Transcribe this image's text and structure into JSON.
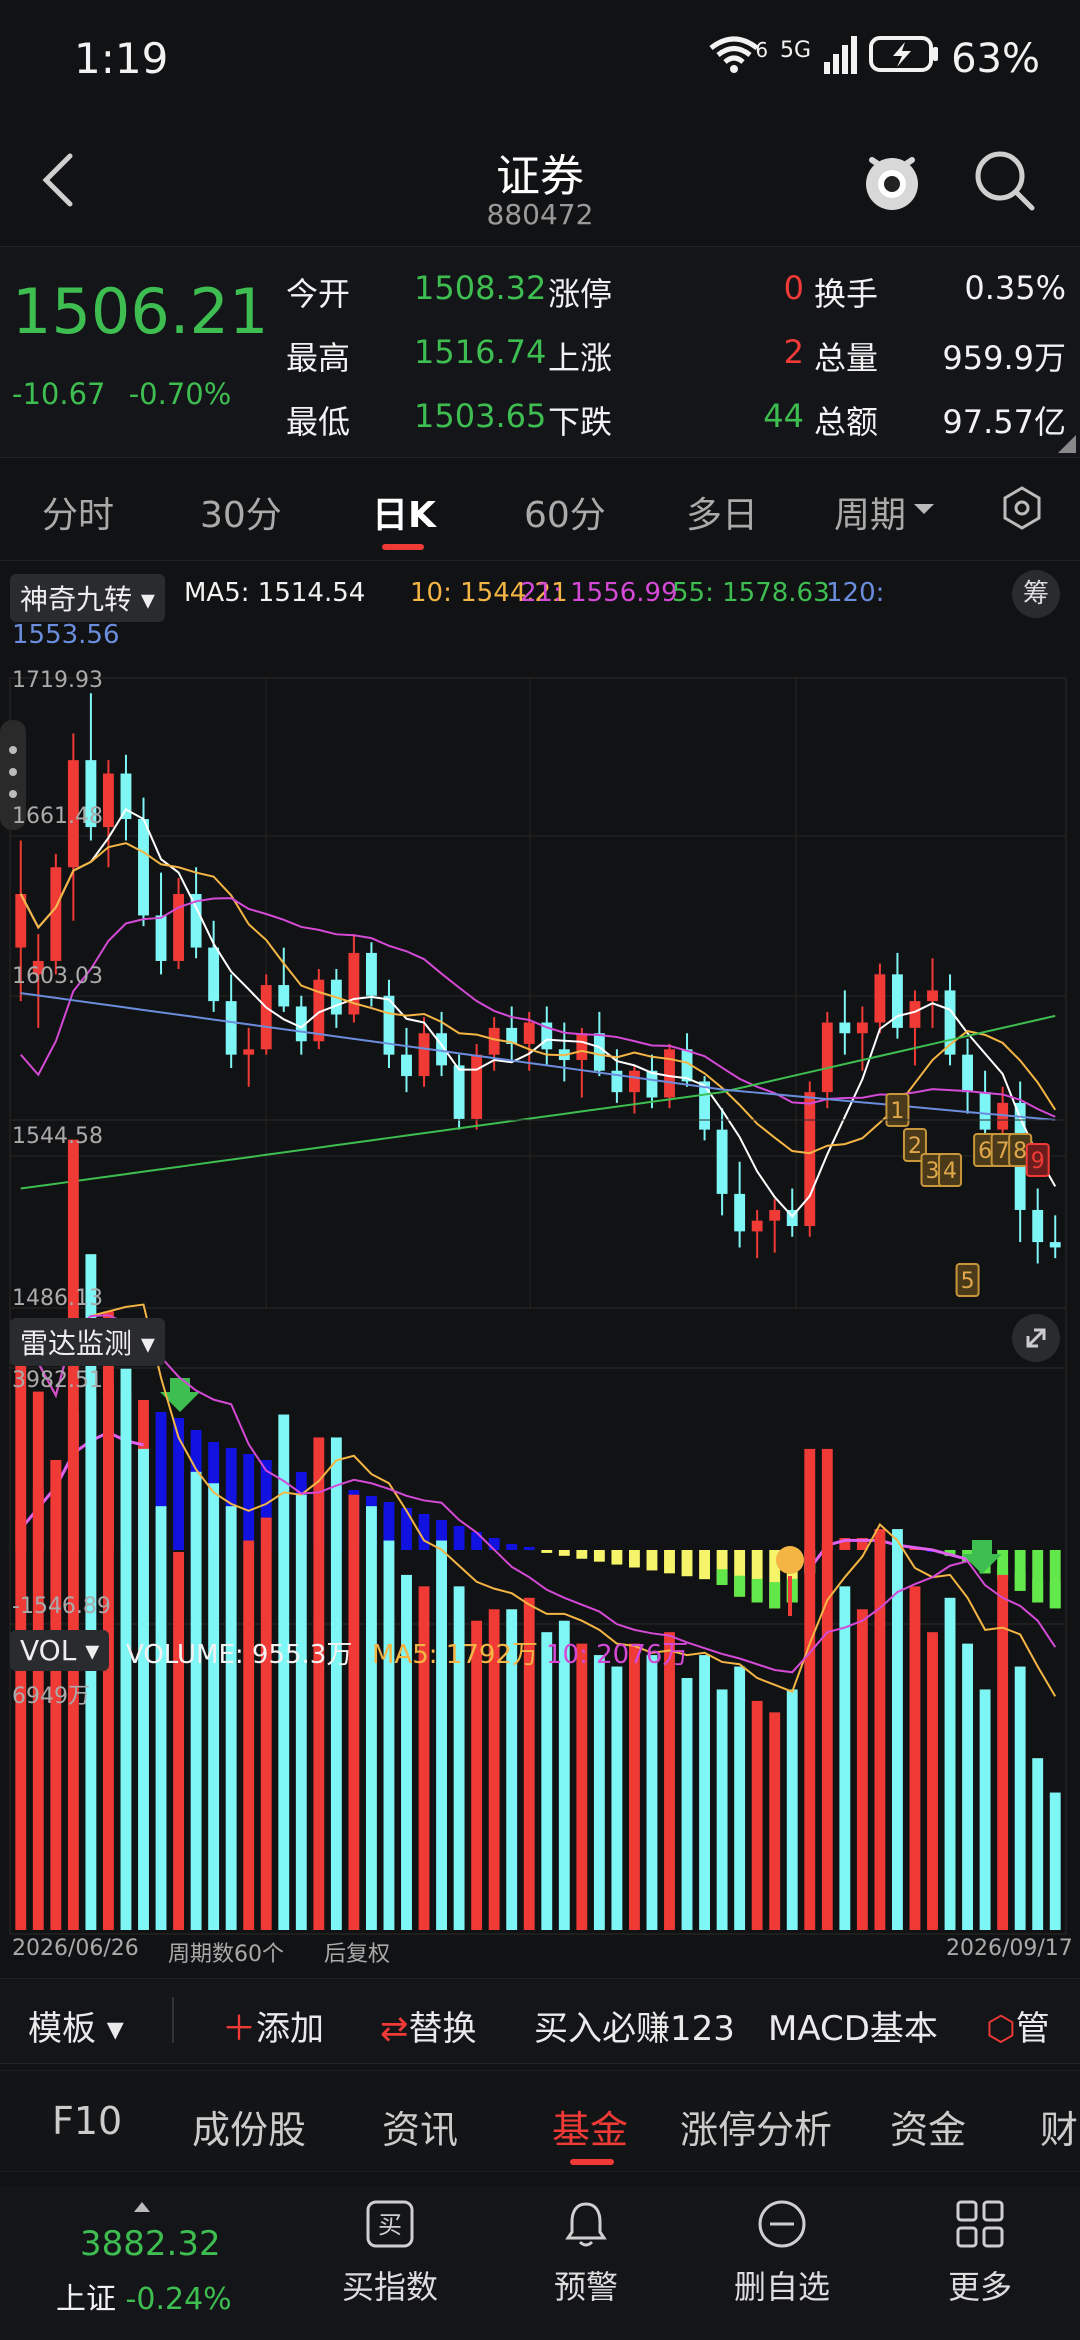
{
  "status": {
    "time": "1:19",
    "signal": "5G",
    "wifi_tag": "6",
    "battery": "63%"
  },
  "header": {
    "title": "证券",
    "code": "880472"
  },
  "quote": {
    "price": "1506.21",
    "change": "-10.67",
    "change_pct": "-0.70%",
    "rows": [
      {
        "label1": "今开",
        "val1": "1508.32",
        "label2": "涨停",
        "val2": "0",
        "label3": "换手",
        "val3": "0.35%"
      },
      {
        "label1": "最高",
        "val1": "1516.74",
        "label2": "上涨",
        "val2": "2",
        "label3": "总量",
        "val3": "959.9万"
      },
      {
        "label1": "最低",
        "val1": "1503.65",
        "label2": "下跌",
        "val2": "44",
        "label3": "总额",
        "val3": "97.57亿"
      }
    ]
  },
  "periods": [
    "分时",
    "30分",
    "日K",
    "60分",
    "多日",
    "周期"
  ],
  "ma_bar": {
    "indicator": "神奇九转",
    "ma5": "MA5: 1514.54",
    "ma10": "10: 1544.21",
    "ma21": "21: 1556.99",
    "ma55": "55: 1578.63",
    "ma120_label": "120:",
    "ma120_value": "1553.56",
    "chip": "筹"
  },
  "price_axis": [
    "1719.93",
    "1661.48",
    "1603.03",
    "1544.58",
    "1486.13"
  ],
  "radar": {
    "label": "雷达监测",
    "top": "3982.51",
    "bottom": "-1546.89"
  },
  "volume": {
    "label": "VOL",
    "volume": "VOLUME: 955.3万",
    "ma5": "MA5: 1792万",
    "ma10": "10: 2076万",
    "top": "6949万",
    "date_start": "2026/06/26",
    "period_count": "周期数60个",
    "adjust": "后复权",
    "date_end": "2026/09/17"
  },
  "nine_markers": [
    "1",
    "2",
    "3",
    "4",
    "5",
    "6",
    "7",
    "8",
    "9"
  ],
  "toolbar": [
    "模板",
    "添加",
    "替换",
    "买入必赚123",
    "MACD基本",
    "管"
  ],
  "bottom_tabs": [
    "F10",
    "成份股",
    "资讯",
    "基金",
    "涨停分析",
    "资金",
    "财"
  ],
  "bottom_bar": {
    "index_value": "3882.32",
    "index_name": "上证",
    "index_change": "-0.24%",
    "buy": "买指数",
    "alert": "预警",
    "remove": "删自选",
    "more": "更多"
  },
  "colors": {
    "up": "#ef3a36",
    "down": "#7ff6f6",
    "green": "#3ebd51",
    "accent": "#ef3a36"
  },
  "chart_data": {
    "type": "candlestick",
    "ohlc": [
      [
        1620,
        1660,
        1600,
        1640
      ],
      [
        1610,
        1625,
        1590,
        1615
      ],
      [
        1615,
        1655,
        1610,
        1650
      ],
      [
        1650,
        1700,
        1630,
        1690
      ],
      [
        1690,
        1715,
        1660,
        1665
      ],
      [
        1665,
        1690,
        1650,
        1685
      ],
      [
        1685,
        1692,
        1660,
        1668
      ],
      [
        1668,
        1676,
        1628,
        1632
      ],
      [
        1632,
        1648,
        1610,
        1615
      ],
      [
        1615,
        1646,
        1612,
        1640
      ],
      [
        1640,
        1650,
        1616,
        1620
      ],
      [
        1620,
        1630,
        1596,
        1600
      ],
      [
        1600,
        1610,
        1575,
        1580
      ],
      [
        1580,
        1590,
        1568,
        1582
      ],
      [
        1582,
        1610,
        1580,
        1606
      ],
      [
        1606,
        1620,
        1596,
        1598
      ],
      [
        1598,
        1602,
        1580,
        1585
      ],
      [
        1585,
        1612,
        1582,
        1608
      ],
      [
        1608,
        1612,
        1590,
        1595
      ],
      [
        1595,
        1625,
        1592,
        1618
      ],
      [
        1618,
        1622,
        1598,
        1602
      ],
      [
        1602,
        1608,
        1575,
        1580
      ],
      [
        1580,
        1590,
        1566,
        1572
      ],
      [
        1572,
        1594,
        1568,
        1588
      ],
      [
        1588,
        1596,
        1572,
        1576
      ],
      [
        1576,
        1580,
        1552,
        1556
      ],
      [
        1556,
        1584,
        1552,
        1580
      ],
      [
        1580,
        1594,
        1574,
        1590
      ],
      [
        1590,
        1598,
        1578,
        1584
      ],
      [
        1584,
        1596,
        1574,
        1592
      ],
      [
        1592,
        1598,
        1576,
        1582
      ],
      [
        1582,
        1592,
        1570,
        1578
      ],
      [
        1578,
        1590,
        1564,
        1588
      ],
      [
        1588,
        1596,
        1572,
        1574
      ],
      [
        1574,
        1582,
        1562,
        1566
      ],
      [
        1566,
        1576,
        1558,
        1574
      ],
      [
        1574,
        1580,
        1560,
        1564
      ],
      [
        1564,
        1584,
        1560,
        1582
      ],
      [
        1582,
        1588,
        1568,
        1570
      ],
      [
        1570,
        1572,
        1548,
        1552
      ],
      [
        1552,
        1560,
        1520,
        1528
      ],
      [
        1528,
        1540,
        1508,
        1514
      ],
      [
        1514,
        1522,
        1504,
        1518
      ],
      [
        1518,
        1526,
        1506,
        1522
      ],
      [
        1522,
        1530,
        1512,
        1516
      ],
      [
        1516,
        1570,
        1512,
        1566
      ],
      [
        1566,
        1596,
        1560,
        1592
      ],
      [
        1592,
        1604,
        1580,
        1588
      ],
      [
        1588,
        1598,
        1574,
        1592
      ],
      [
        1592,
        1614,
        1588,
        1610
      ],
      [
        1610,
        1618,
        1586,
        1590
      ],
      [
        1590,
        1604,
        1576,
        1600
      ],
      [
        1600,
        1616,
        1590,
        1604
      ],
      [
        1604,
        1610,
        1576,
        1580
      ],
      [
        1580,
        1586,
        1558,
        1566
      ],
      [
        1566,
        1574,
        1546,
        1552
      ],
      [
        1552,
        1568,
        1540,
        1562
      ],
      [
        1562,
        1570,
        1510,
        1522
      ],
      [
        1522,
        1530,
        1502,
        1510
      ],
      [
        1510,
        1520,
        1504,
        1508
      ]
    ],
    "ylim": [
      1486.13,
      1719.93
    ],
    "volume": [
      5200,
      4700,
      4100,
      6900,
      5900,
      5400,
      4900,
      4200,
      3700,
      3300,
      4000,
      3900,
      3700,
      3400,
      3600,
      4500,
      3800,
      4300,
      4300,
      3800,
      3700,
      3400,
      3100,
      3000,
      3400,
      3000,
      2700,
      2800,
      2800,
      2900,
      2600,
      2700,
      2500,
      2400,
      2300,
      2500,
      2400,
      2600,
      2200,
      2400,
      2100,
      2300,
      2000,
      1900,
      2100,
      4200,
      4200,
      3000,
      2800,
      3500,
      3500,
      3000,
      2600,
      2900,
      2500,
      2100,
      3100,
      2300,
      1500,
      1200
    ],
    "macd": [
      0.5,
      1.0,
      1.5,
      2.3,
      2.6,
      2.8,
      2.6,
      2.5,
      2.3,
      2.2,
      2.0,
      1.8,
      1.7,
      1.6,
      1.5,
      1.4,
      1.3,
      1.2,
      1.1,
      1.0,
      0.9,
      0.8,
      0.7,
      0.6,
      0.5,
      0.4,
      0.3,
      0.2,
      0.1,
      0.05,
      -0.05,
      -0.1,
      -0.15,
      -0.2,
      -0.25,
      -0.3,
      -0.35,
      -0.4,
      -0.45,
      -0.5,
      -0.6,
      -0.8,
      -0.9,
      -1.0,
      -0.9,
      -0.4,
      0.1,
      0.2,
      0.2,
      0.2,
      0.1,
      0.05,
      0.0,
      -0.1,
      -0.2,
      -0.4,
      -0.5,
      -0.7,
      -0.9,
      -1.0
    ]
  }
}
